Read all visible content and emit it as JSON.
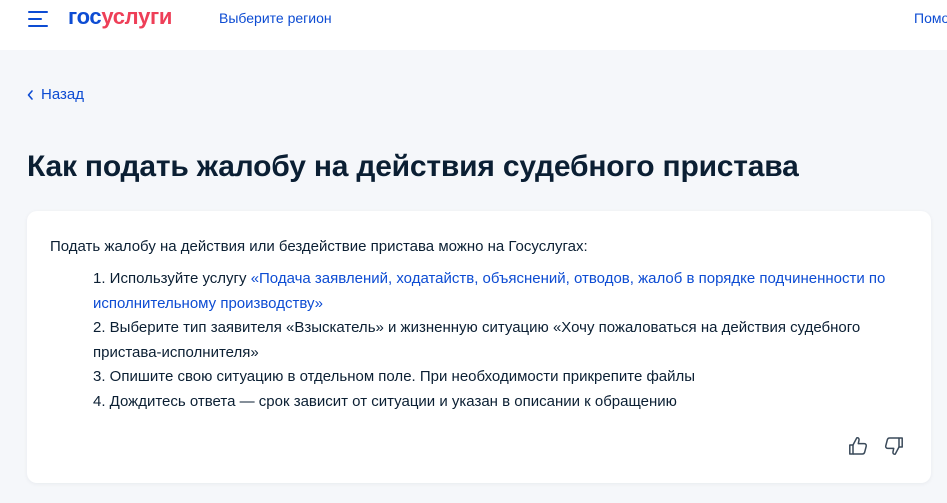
{
  "header": {
    "logo": {
      "part1": "гос",
      "part2": "услуги"
    },
    "region_label": "Выберите регион",
    "help_label": "Помощь"
  },
  "nav": {
    "back_label": "Назад"
  },
  "page": {
    "title": "Как подать жалобу на действия судебного пристава"
  },
  "card": {
    "intro": "Подать жалобу на действия или бездействие пристава можно на Госуслугах:",
    "steps": [
      {
        "prefix": "1. Используйте услугу ",
        "link": "«Подача заявлений, ходатайств, объяснений, отводов, жалоб в порядке подчиненности по исполнительному производству»"
      },
      {
        "text": "2. Выберите тип заявителя «Взыскатель» и жизненную ситуацию «Хочу пожаловаться на действия судебного пристава-исполнителя»"
      },
      {
        "text": "3. Опишите свою ситуацию в отдельном поле. При необходимости прикрепите файлы"
      },
      {
        "text": "4. Дождитесь ответа — срок зависит от ситуации и указан в описании к обращению"
      }
    ],
    "feedback_icons": [
      "thumb-up-icon",
      "thumb-down-icon"
    ]
  },
  "colors": {
    "accent": "#0d4cd3",
    "logo_red": "#ee3f58",
    "text": "#0b1f33",
    "background": "#f5f7fa",
    "card": "#ffffff"
  }
}
